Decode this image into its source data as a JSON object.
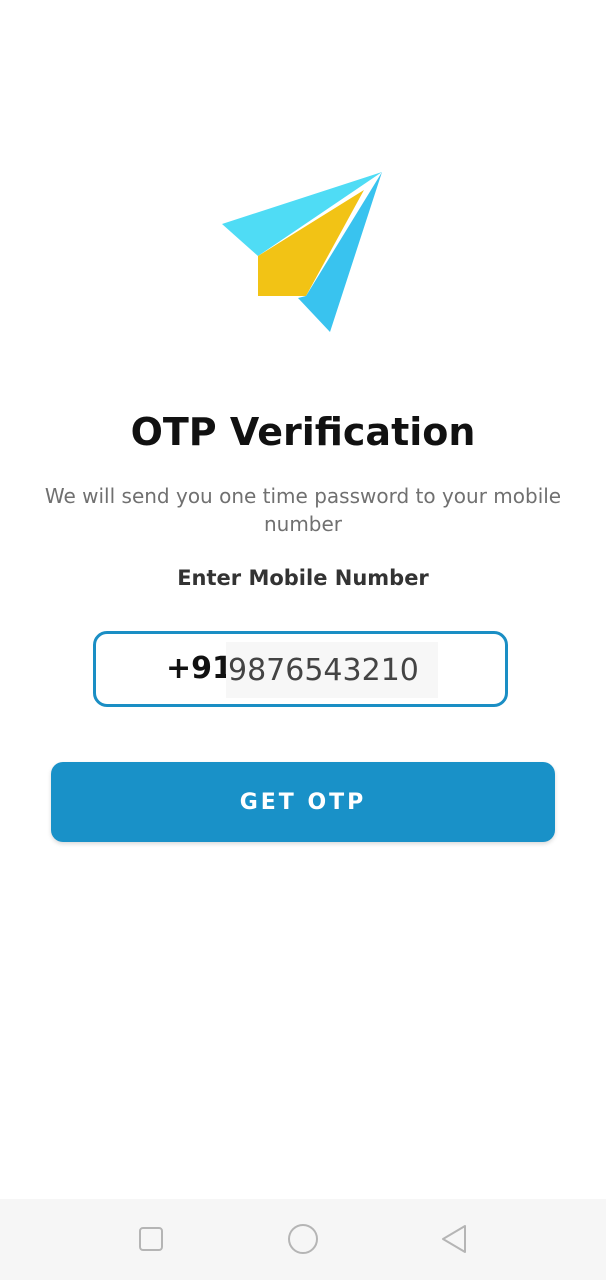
{
  "screen": {
    "title": "OTP Verification",
    "subtitle": "We will send you one time password to your mobile number",
    "label": "Enter Mobile Number"
  },
  "phone": {
    "country_code": "+91",
    "number": "9876543210"
  },
  "button": {
    "label": "GET OTP"
  },
  "colors": {
    "accent": "#1991c8",
    "logo_light_blue": "#4fdcf5",
    "logo_blue": "#39c3ef",
    "logo_yellow": "#f2c315"
  },
  "navbar": {
    "icons": [
      "square-icon",
      "circle-icon",
      "back-triangle-icon"
    ]
  }
}
